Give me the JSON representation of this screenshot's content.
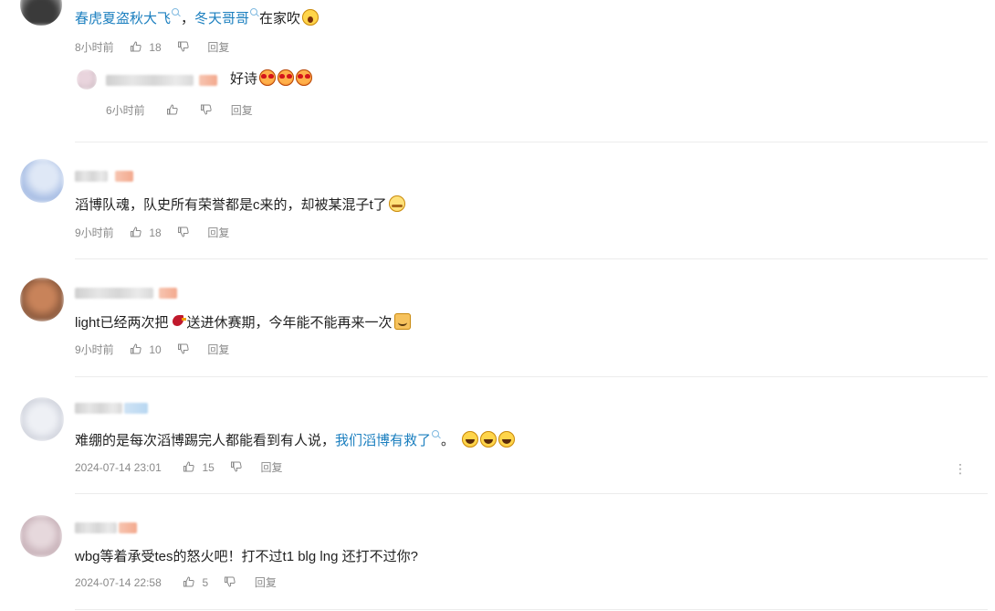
{
  "comments": [
    {
      "id": "c1",
      "text_parts": [
        {
          "type": "link",
          "text": "春虎夏盗秋大飞"
        },
        {
          "type": "text",
          "text": "，"
        },
        {
          "type": "link",
          "text": "冬天哥哥"
        },
        {
          "type": "text",
          "text": "在家吹"
        },
        {
          "type": "emoji",
          "name": "shock-emoji"
        }
      ],
      "time": "8小时前",
      "likes": "18",
      "reply_label": "回复",
      "replies": [
        {
          "text": "好诗",
          "emojis": [
            "heart-eyes-emoji",
            "heart-eyes-emoji",
            "heart-eyes-emoji"
          ],
          "time": "6小时前",
          "reply_label": "回复"
        }
      ]
    },
    {
      "id": "c2",
      "text": "滔博队魂，队史所有荣誉都是c来的，却被某混子t了",
      "emoji": "sweat-smile-emoji",
      "time": "9小时前",
      "likes": "18",
      "reply_label": "回复"
    },
    {
      "id": "c3",
      "text_a": "light已经两次把",
      "emoji_a": "bird-emoji",
      "text_b": "送进休赛期，今年能不能再来一次",
      "emoji_b": "cat-emoji",
      "time": "9小时前",
      "likes": "10",
      "reply_label": "回复"
    },
    {
      "id": "c4",
      "text": "难绷的是每次滔博踢完人都能看到有人说，",
      "link": "我们滔博有救了",
      "text_after": "。",
      "emojis": [
        "rofl-emoji",
        "rofl-emoji",
        "rofl-emoji"
      ],
      "time": "2024-07-14 23:01",
      "likes": "15",
      "reply_label": "回复",
      "more": "⋮"
    },
    {
      "id": "c5",
      "text": "wbg等着承受tes的怒火吧！打不过t1 blg lng 还打不过你?",
      "time": "2024-07-14 22:58",
      "likes": "5",
      "reply_label": "回复"
    }
  ],
  "colors": {
    "link": "#1b7fbf",
    "meta": "#8a8a8a",
    "divider": "#ececec"
  },
  "icons": {
    "like": "thumbs-up-icon",
    "dislike": "thumbs-down-icon",
    "link_mark": "search-link-icon"
  }
}
